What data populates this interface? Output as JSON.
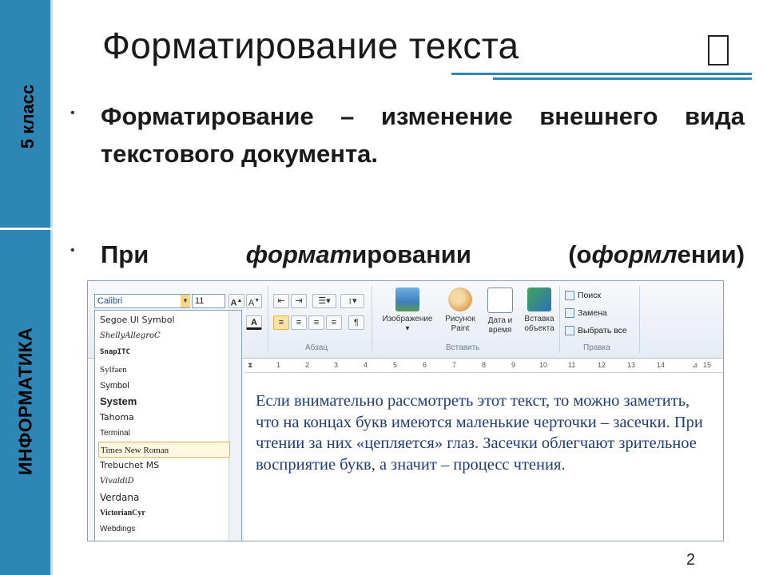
{
  "sidebar": {
    "grade": "5 класс",
    "subject": "ИНФОРМАТИКА"
  },
  "slide": {
    "title": "Форматирование текста",
    "title_icon": "document-icon",
    "bullets": {
      "p1": "Форматирование – изменение внешнего вида текстового документа.",
      "p2_a": "При ",
      "p2_b": "формат",
      "p2_c": "ировании (о",
      "p2_d": "формл",
      "p2_e": "ении)"
    },
    "page_number": "2"
  },
  "screenshot": {
    "font_name": "Calibri",
    "font_size": "11",
    "font_list": [
      "Segoe UI Symbol",
      "ShellyAllegroC",
      "SnapITC",
      "Sylfaen",
      "Symbol",
      "System",
      "Tahoma",
      "Terminal",
      "Times New Roman",
      "Trebuchet MS",
      "VivaldiD",
      "Verdana",
      "VictorianCyr",
      "Webdings"
    ],
    "selected_font": "Times New Roman",
    "groups": {
      "paragraph": "Абзац",
      "insert": "Вставить",
      "editing": "Правка"
    },
    "insert_buttons": [
      {
        "label": "Изображение",
        "icon": "picture-icon"
      },
      {
        "label": "Рисунок Paint",
        "icon": "paint-palette-icon"
      },
      {
        "label": "Дата и время",
        "icon": "calendar-clock-icon"
      },
      {
        "label": "Вставка объекта",
        "icon": "insert-object-icon"
      }
    ],
    "edit_items": [
      "Поиск",
      "Замена",
      "Выбрать все"
    ],
    "ruler_numbers": [
      "1",
      "2",
      "3",
      "4",
      "5",
      "6",
      "7",
      "8",
      "9",
      "10",
      "11",
      "12",
      "13",
      "14",
      "15"
    ],
    "document_text": "Если внимательно рассмотреть этот текст, то можно заметить, что на концах букв имеются маленькие черточки – засечки. При чтении за них «цепляется» глаз. Засечки облегчают зрительное восприятие букв, а значит – процесс чтения.",
    "colors": {
      "accent_blue": "#2e86b4",
      "doc_text": "#1f3d78"
    }
  }
}
